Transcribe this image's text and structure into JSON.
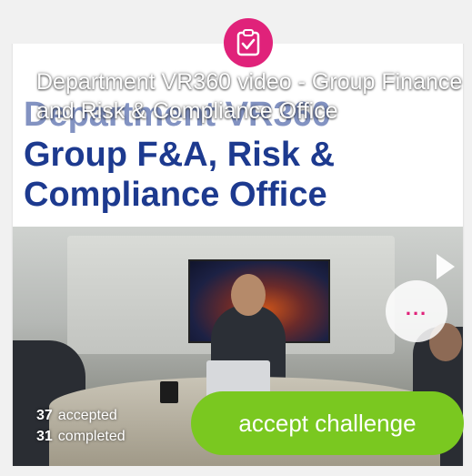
{
  "card": {
    "badge_icon": "clipboard-check-icon",
    "overlay_title": "Department VR360 video - Group Finance and Risk & Compliance Office",
    "slide": {
      "line1": "Department VR360",
      "line2": "Group F&A, Risk &",
      "line3": "Compliance Office"
    },
    "more_icon": "ellipsis-icon",
    "more_label": "...",
    "stats": {
      "accepted_count": "37",
      "accepted_label": "accepted",
      "completed_count": "31",
      "completed_label": "completed"
    },
    "accept_button_label": "accept challenge"
  },
  "colors": {
    "accent": "#e0227a",
    "button_green": "#7ac820",
    "slide_text": "#1d3a8f"
  }
}
